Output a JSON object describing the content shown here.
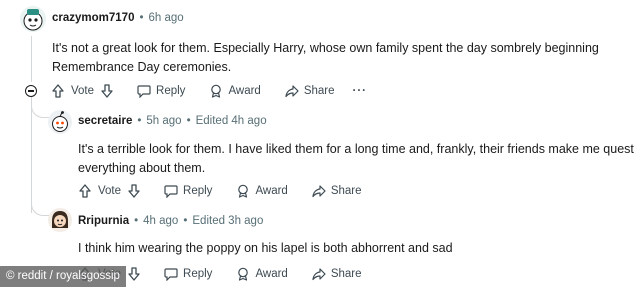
{
  "comments": [
    {
      "username": "crazymom7170",
      "time": "6h ago",
      "edited": "",
      "body_lines": [
        "It's not a great look for them. Especially Harry, whose own family spent the day sombrely beginning",
        "Remembrance Day ceremonies."
      ]
    },
    {
      "username": "secretaire",
      "time": "5h ago",
      "edited": "Edited 4h ago",
      "body_lines": [
        "It's a terrible look for them. I have liked them for a long time and, frankly, their friends make me question",
        "everything about them."
      ]
    },
    {
      "username": "Rripurnia",
      "time": "4h ago",
      "edited": "Edited 3h ago",
      "body_lines": [
        "I think him wearing the poppy on his lapel is both abhorrent and sad"
      ]
    }
  ],
  "actions": {
    "vote": "Vote",
    "reply": "Reply",
    "award": "Award",
    "share": "Share",
    "more": "···"
  },
  "dot": "•",
  "watermark": "© reddit / royalsgossip",
  "icons": [
    "collapse-icon",
    "upvote-icon",
    "downvote-icon",
    "reply-icon",
    "award-icon",
    "share-icon",
    "more-icon"
  ],
  "colors": {
    "text": "#1a1a1b",
    "meta": "#576f76",
    "thread_line": "#d4d7d9"
  }
}
